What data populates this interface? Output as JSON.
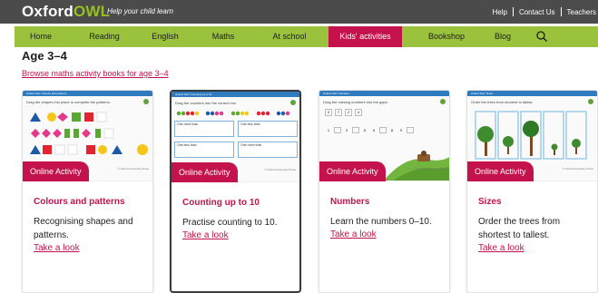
{
  "header": {
    "logo_prefix": "Oxford",
    "logo_suffix": "OWL",
    "tagline": "Help your child learn",
    "links": [
      "Help",
      "Contact Us",
      "Teachers"
    ]
  },
  "nav": {
    "items": [
      "Home",
      "Reading",
      "English",
      "Maths",
      "At school",
      "Kids' activities",
      "Bookshop",
      "Blog"
    ],
    "active": "Kids' activities",
    "search_icon": "search-icon"
  },
  "page": {
    "title": "Age 3–4",
    "browse_link": "Browse maths activity books for age 3–4"
  },
  "cards": [
    {
      "badge": "Online Activity",
      "title": "Colours and patterns",
      "description": "Recognising shapes and patterns.",
      "link": "Take a look",
      "thumb_title": "Oxford Owl: Colours and patterns",
      "thumb_instruction": "Drag the shapes into place to complete the patterns."
    },
    {
      "badge": "Online Activity",
      "title": "Counting up to 10",
      "description": "Practise counting to 10.",
      "link": "Take a look",
      "thumb_title": "Oxford Owl: Counting up to 10",
      "thumb_instruction": "Drag the counters into the correct box.",
      "thumb_boxes": [
        "One more than",
        "One less than",
        "One less than",
        "One more than"
      ]
    },
    {
      "badge": "Online Activity",
      "title": "Numbers",
      "description": "Learn the numbers 0–10.",
      "link": "Take a look",
      "thumb_title": "Oxford Owl: Numbers",
      "thumb_instruction": "Drag the missing numbers into the gaps.",
      "thumb_numbers_top": [
        "0",
        "7",
        "2",
        "4"
      ],
      "thumb_sequence": [
        "1",
        "",
        "3",
        "",
        "5",
        "6",
        "",
        "8",
        "9",
        ""
      ]
    },
    {
      "badge": "Online Activity",
      "title": "Sizes",
      "description": "Order the trees from shortest to tallest.",
      "link": "Take a look",
      "thumb_title": "Oxford Owl: Sizes",
      "thumb_instruction": "Order the trees from shortest to tallest."
    }
  ],
  "thumb_copyright": "© Oxford University Press"
}
